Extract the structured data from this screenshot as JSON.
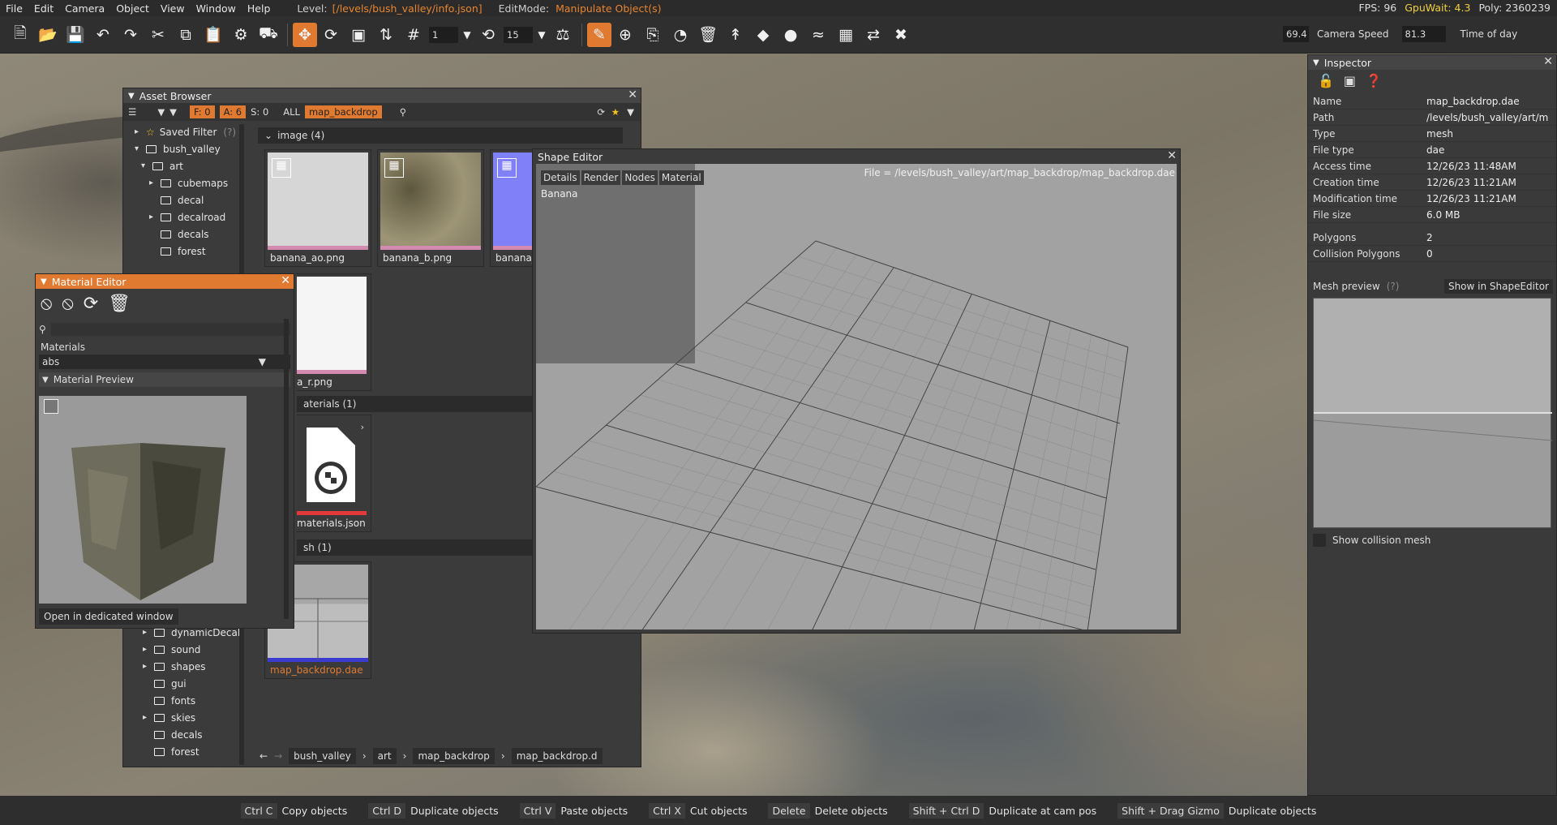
{
  "menu": {
    "items": [
      "File",
      "Edit",
      "Camera",
      "Object",
      "View",
      "Window",
      "Help"
    ],
    "level_label": "Level:",
    "level_path": "[/levels/bush_valley/info.json]",
    "editmode_label": "EditMode:",
    "editmode_value": "Manipulate Object(s)",
    "fps": "FPS: 96",
    "gpuwait": "GpuWait: 4.3",
    "poly": "Poly: 2360239"
  },
  "toolbar": {
    "snap_value": "1",
    "rotate_value": "15",
    "fov_value": "69.4",
    "camera_speed_label": "Camera Speed",
    "camera_speed_value": "81.3",
    "time_of_day_label": "Time of day"
  },
  "asset_browser": {
    "title": "Asset Browser",
    "f_count": "F: 0",
    "a_count": "A: 6",
    "s_count": "S: 0",
    "all": "ALL",
    "filter_tag": "map_backdrop",
    "saved_filter": "Saved Filter",
    "saved_filter_help": "(?)",
    "tree": [
      "bush_valley",
      "art",
      "cubemaps",
      "decal",
      "decalroad",
      "decals",
      "forest"
    ],
    "tree_bottom": [
      "dynamicDecal",
      "sound",
      "shapes",
      "gui",
      "fonts",
      "skies",
      "decals",
      "forest"
    ],
    "section_image": "image (4)",
    "section_materials": "aterials (1)",
    "section_mesh": "sh (1)",
    "thumbs": {
      "t1": "banana_ao.png",
      "t2": "banana_b.png",
      "t3": "banana_n",
      "t4": "a_r.png",
      "t5": "materials.json",
      "t6": "map_backdrop.dae"
    },
    "crumbs": [
      "bush_valley",
      "art",
      "map_backdrop",
      "map_backdrop.d"
    ]
  },
  "shape_editor": {
    "title": "Shape Editor",
    "file": "File = /levels/bush_valley/art/map_backdrop/map_backdrop.dae",
    "tabs": [
      "Details",
      "Render",
      "Nodes",
      "Material"
    ],
    "material": "Banana"
  },
  "material_editor": {
    "title": "Material Editor",
    "materials_label": "Materials",
    "selected": "abs",
    "preview_label": "Material Preview",
    "open_button": "Open in dedicated window"
  },
  "inspector": {
    "title": "Inspector",
    "rows": [
      {
        "k": "Name",
        "v": "map_backdrop.dae"
      },
      {
        "k": "Path",
        "v": "/levels/bush_valley/art/m"
      },
      {
        "k": "Type",
        "v": "mesh"
      },
      {
        "k": "File type",
        "v": "dae"
      },
      {
        "k": "Access time",
        "v": "12/26/23 11:48AM"
      },
      {
        "k": "Creation time",
        "v": "12/26/23 11:21AM"
      },
      {
        "k": "Modification time",
        "v": "12/26/23 11:21AM"
      },
      {
        "k": "File size",
        "v": "6.0 MB"
      }
    ],
    "rows2": [
      {
        "k": "Polygons",
        "v": "2"
      },
      {
        "k": "Collision Polygons",
        "v": "0"
      }
    ],
    "mesh_preview": "Mesh preview",
    "mesh_help": "(?)",
    "show_in_shapeeditor": "Show in ShapeEditor",
    "show_collision": "Show collision mesh"
  },
  "status": [
    {
      "key": "Ctrl C",
      "label": "Copy objects"
    },
    {
      "key": "Ctrl D",
      "label": "Duplicate objects"
    },
    {
      "key": "Ctrl V",
      "label": "Paste objects"
    },
    {
      "key": "Ctrl X",
      "label": "Cut objects"
    },
    {
      "key": "Delete",
      "label": "Delete objects"
    },
    {
      "key": "Shift + Ctrl D",
      "label": "Duplicate at cam pos"
    },
    {
      "key": "Shift + Drag Gizmo",
      "label": "Duplicate objects"
    }
  ]
}
